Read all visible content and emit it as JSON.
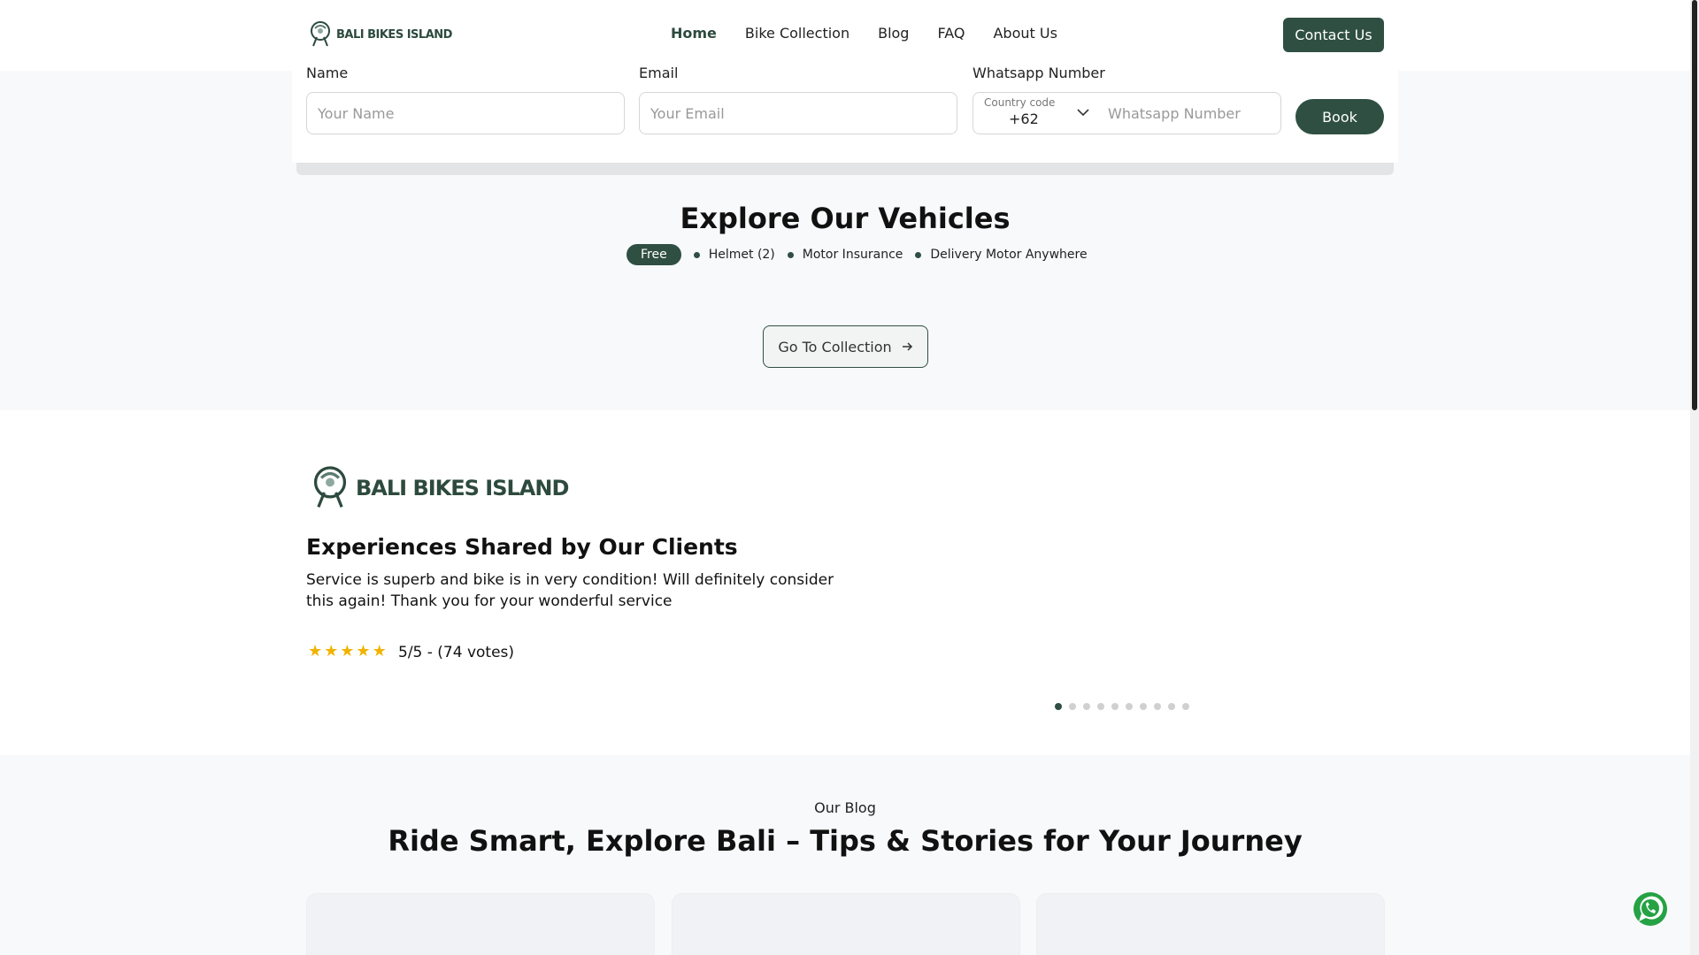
{
  "brand": {
    "name": "BALI BIKES ISLAND"
  },
  "nav": {
    "items": [
      {
        "label": "Home",
        "active": true
      },
      {
        "label": "Bike Collection"
      },
      {
        "label": "Blog"
      },
      {
        "label": "FAQ"
      },
      {
        "label": "About Us"
      }
    ],
    "contact_label": "Contact Us"
  },
  "booking": {
    "name_label": "Name",
    "name_placeholder": "Your Name",
    "email_label": "Email",
    "email_placeholder": "Your Email",
    "whatsapp_label": "Whatsapp Number",
    "country_code_label": "Country code",
    "country_code_value": "+62",
    "whatsapp_placeholder": "Whatsapp Number",
    "book_label": "Book"
  },
  "vehicles": {
    "title": "Explore Our Vehicles",
    "free_badge": "Free",
    "features": [
      "Helmet (2)",
      "Motor Insurance",
      "Delivery Motor Anywhere"
    ],
    "collection_button": "Go To Collection"
  },
  "testimonials": {
    "title": "Experiences Shared by Our Clients",
    "quote": "Service is superb and bike is in very condition! Will definitely consider this again! Thank you for your wonderful service",
    "stars": 5,
    "rating_text": "5/5 - (74 votes)",
    "slides": 10,
    "active_slide": 1
  },
  "blog": {
    "eyebrow": "Our Blog",
    "title": "Ride Smart, Explore Bali – Tips & Stories for Your Journey"
  },
  "colors": {
    "brand": "#2f4f43",
    "star": "#f0b400"
  },
  "icons": {
    "fab": "whatsapp-icon",
    "collection_arrow": "arrow-right-icon"
  }
}
